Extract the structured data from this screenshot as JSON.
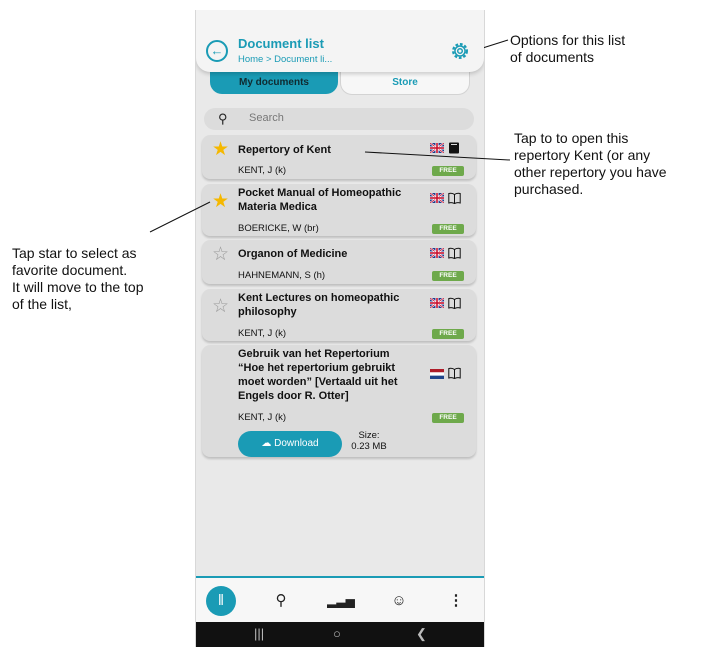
{
  "header": {
    "title": "Document list",
    "breadcrumb": "Home > Document li..."
  },
  "tabs": {
    "my_documents": "My documents",
    "store": "Store"
  },
  "search": {
    "placeholder": "Search"
  },
  "documents": [
    {
      "title": "Repertory of Kent",
      "author": "KENT, J (k)",
      "badge": "FREE",
      "favorite": true,
      "language": "en",
      "owned": true
    },
    {
      "title": "Pocket Manual of Homeopathic Materia Medica",
      "author": "BOERICKE, W (br)",
      "badge": "FREE",
      "favorite": true,
      "language": "en",
      "owned": false
    },
    {
      "title": "Organon of Medicine",
      "author": "HAHNEMANN, S (h)",
      "badge": "FREE",
      "favorite": false,
      "language": "en",
      "owned": false
    },
    {
      "title": "Kent Lectures on homeopathic philosophy",
      "author": "KENT, J (k)",
      "badge": "FREE",
      "favorite": false,
      "language": "en",
      "owned": false
    },
    {
      "title": "Gebruik van het Repertorium “Hoe het repertorium gebruikt moet worden” [Vertaald uit het Engels door R. Otter]",
      "author": "KENT, J (k)",
      "badge": "FREE",
      "favorite": false,
      "language": "nl",
      "owned": false,
      "download_label": "Download",
      "size_label": "Size:",
      "size_value": "0.23 MB"
    }
  ],
  "annotations": {
    "options": "Options for this list\nof documents",
    "open": "Tap to to open this\nrepertory Kent (or any\nother repertory you have\npurchased.",
    "star": "Tap star to select as\nfavorite document.\nIt will move to the top\nof the list,"
  },
  "colors": {
    "accent": "#1a9bb5",
    "free_badge": "#6ea94b",
    "star": "#f5b800"
  }
}
